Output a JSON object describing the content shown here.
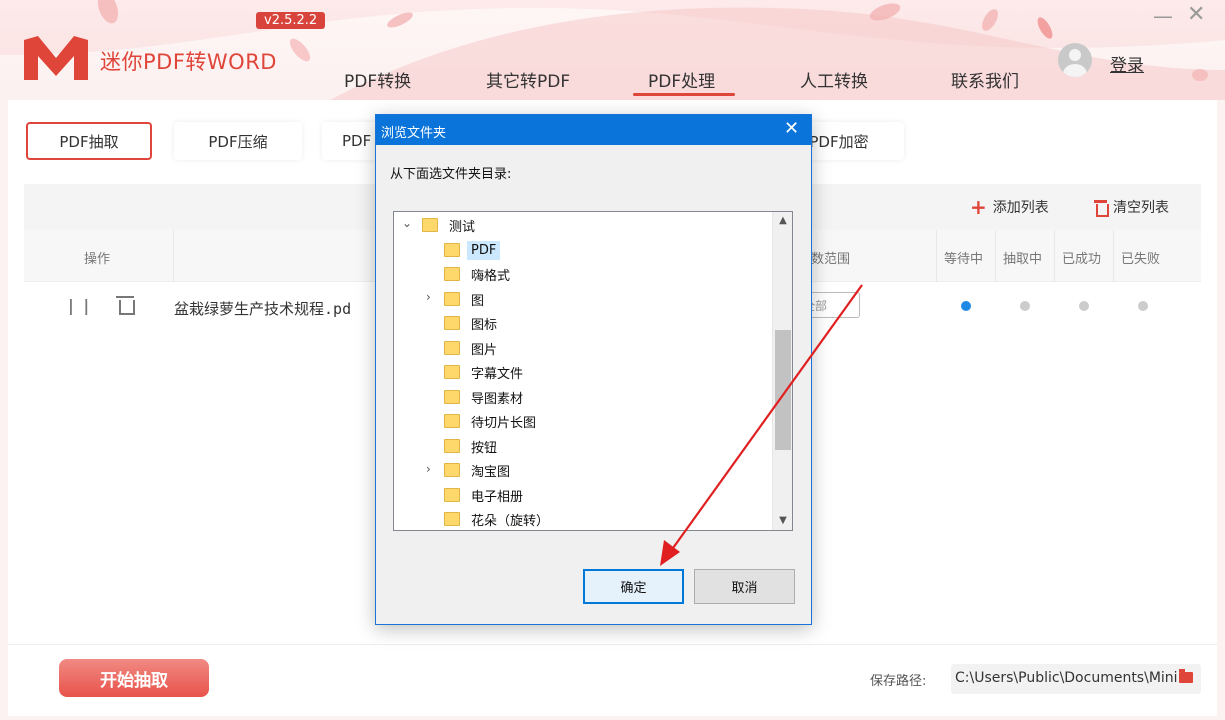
{
  "app": {
    "title": "迷你PDF转WORD",
    "version": "v2.5.2.2",
    "login": "登录",
    "window_min": "—",
    "window_close": "✕"
  },
  "nav": {
    "items": [
      {
        "label": "PDF转换"
      },
      {
        "label": "其它转PDF"
      },
      {
        "label": "PDF处理",
        "active": true
      },
      {
        "label": "人工转换"
      },
      {
        "label": "联系我们"
      }
    ]
  },
  "subtabs": [
    {
      "label": "PDF抽取",
      "active": true
    },
    {
      "label": "PDF压缩"
    },
    {
      "label": "PDF"
    },
    {
      "label": "PDF加密"
    }
  ],
  "list": {
    "add_list": "添加列表",
    "clear_list": "清空列表",
    "columns": {
      "action": "操作",
      "range": "页数范围",
      "waiting": "等待中",
      "extracting": "抽取中",
      "success": "已成功",
      "failed": "已失败"
    },
    "rows": [
      {
        "filename": "盆栽绿萝生产技术规程.pd",
        "range": "全部",
        "status": "waiting"
      }
    ]
  },
  "bottom": {
    "start_button": "开始抽取",
    "save_label": "保存路径:",
    "save_path": "C:\\Users\\Public\\Documents\\Mini"
  },
  "dialog": {
    "title": "浏览文件夹",
    "prompt": "从下面选文件夹目录:",
    "ok": "确定",
    "cancel": "取消",
    "tree": [
      {
        "label": "测试",
        "level": 0,
        "expander": "⌄"
      },
      {
        "label": "PDF",
        "level": 1,
        "selected": true
      },
      {
        "label": "嗨格式",
        "level": 1
      },
      {
        "label": "图",
        "level": 1,
        "expander": "›"
      },
      {
        "label": "图标",
        "level": 1
      },
      {
        "label": "图片",
        "level": 1
      },
      {
        "label": "字幕文件",
        "level": 1
      },
      {
        "label": "导图素材",
        "level": 1
      },
      {
        "label": "待切片长图",
        "level": 1
      },
      {
        "label": "按钮",
        "level": 1
      },
      {
        "label": "淘宝图",
        "level": 1,
        "expander": "›"
      },
      {
        "label": "电子相册",
        "level": 1
      },
      {
        "label": "花朵（旋转）",
        "level": 1
      }
    ]
  },
  "colors": {
    "accent": "#e0453a",
    "dialog_title_bg": "#0a74da",
    "status_active": "#1e88e5",
    "status_inactive": "#cccccc"
  }
}
